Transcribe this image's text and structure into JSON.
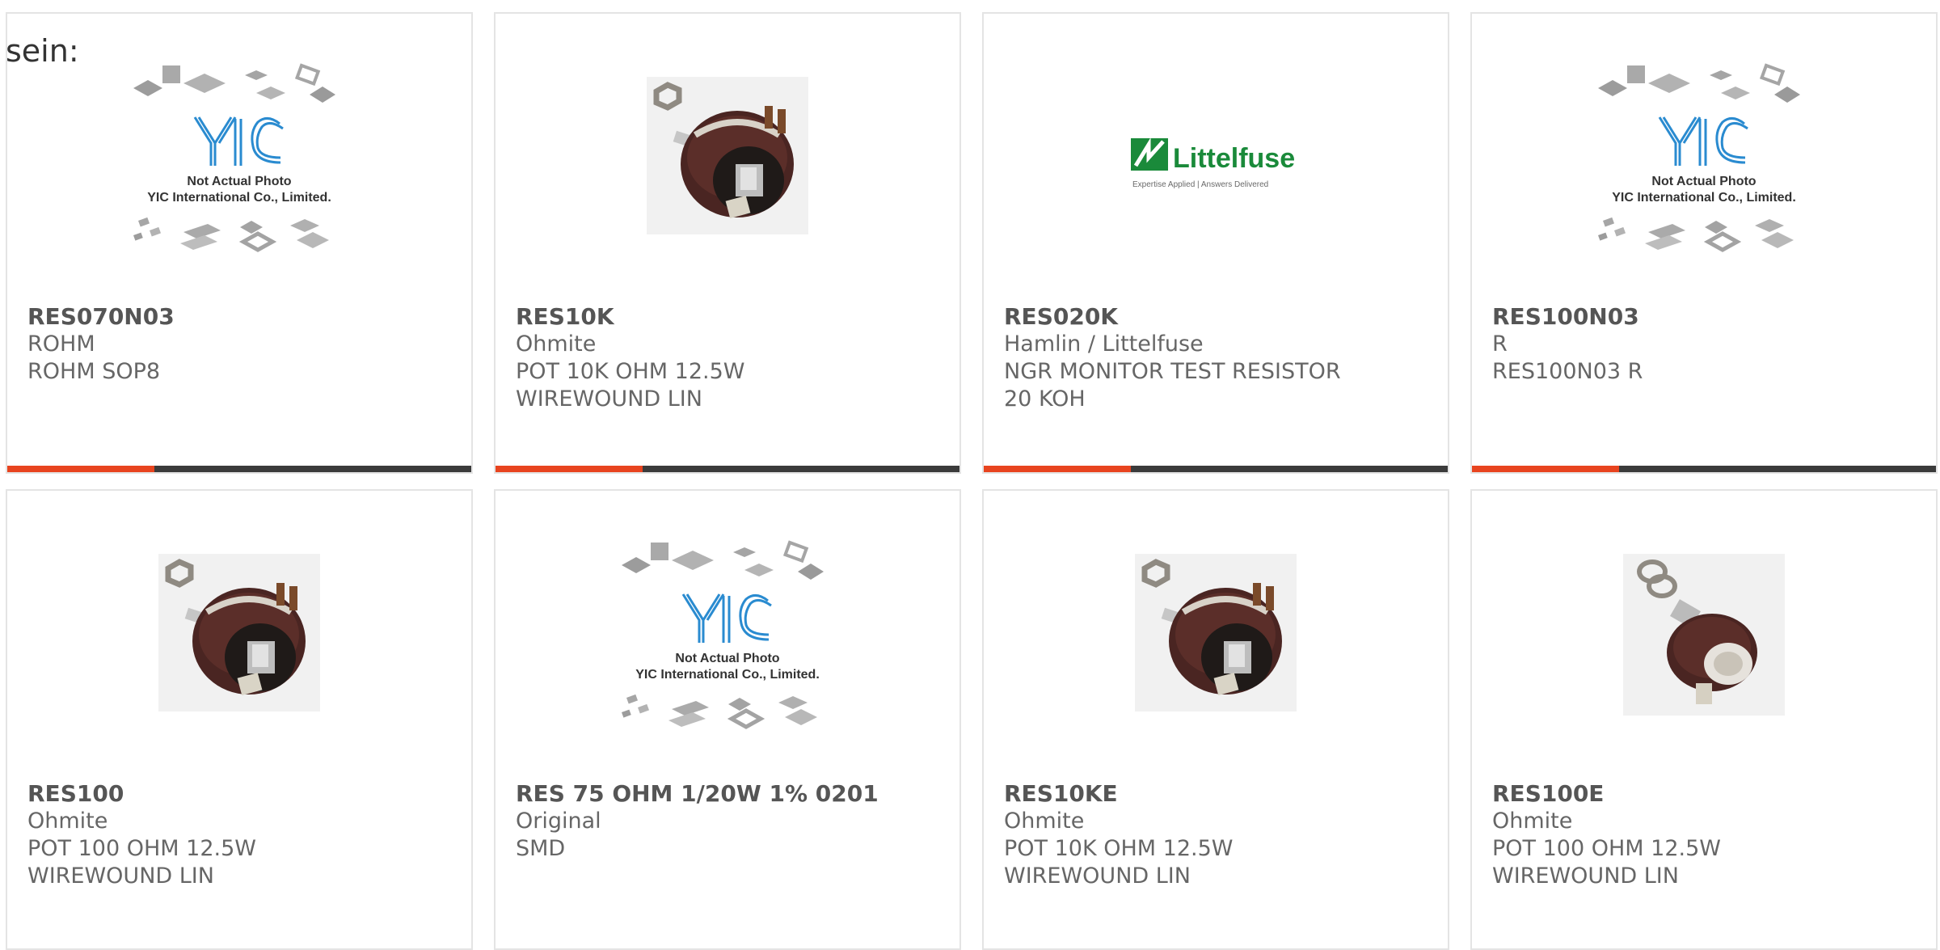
{
  "intro_text": "sein:",
  "colors": {
    "accent": "#e8441f",
    "bar": "#3b3b3b",
    "yic_blue": "#2a8bd0",
    "littelfuse_green": "#1a8a3a"
  },
  "products": [
    {
      "part": "RES070N03",
      "maker": "ROHM",
      "desc1": "ROHM SOP8",
      "desc2": "",
      "image": "yic-placeholder",
      "photo_text_1": "Not Actual Photo",
      "photo_text_2": "YIC International Co., Limited."
    },
    {
      "part": "RES10K",
      "maker": "Ohmite",
      "desc1": "POT 10K OHM 12.5W",
      "desc2": "WIREWOUND LIN",
      "image": "potentiometer-photo"
    },
    {
      "part": "RES020K",
      "maker": "Hamlin / Littelfuse",
      "desc1": "NGR MONITOR TEST RESISTOR",
      "desc2": "20 KOH",
      "image": "littelfuse-logo",
      "logo_text": "Littelfuse",
      "logo_tagline": "Expertise Applied | Answers Delivered"
    },
    {
      "part": "RES100N03",
      "maker": "R",
      "desc1": "RES100N03 R",
      "desc2": "",
      "image": "yic-placeholder",
      "photo_text_1": "Not Actual Photo",
      "photo_text_2": "YIC International Co., Limited."
    },
    {
      "part": "RES100",
      "maker": "Ohmite",
      "desc1": "POT 100 OHM 12.5W",
      "desc2": "WIREWOUND LIN",
      "image": "potentiometer-photo"
    },
    {
      "part": "RES 75 OHM 1/20W 1% 0201",
      "maker": "Original",
      "desc1": "SMD",
      "desc2": "",
      "image": "yic-placeholder",
      "photo_text_1": "Not Actual Photo",
      "photo_text_2": "YIC International Co., Limited."
    },
    {
      "part": "RES10KE",
      "maker": "Ohmite",
      "desc1": "POT 10K OHM 12.5W",
      "desc2": "WIREWOUND LIN",
      "image": "potentiometer-photo"
    },
    {
      "part": "RES100E",
      "maker": "Ohmite",
      "desc1": "POT 100 OHM 12.5W",
      "desc2": "WIREWOUND LIN",
      "image": "potentiometer-side-photo"
    }
  ]
}
